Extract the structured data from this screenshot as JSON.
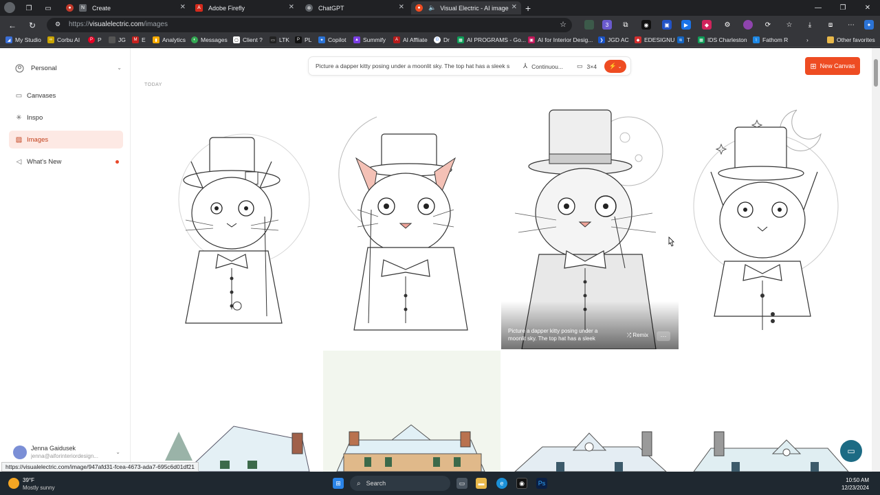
{
  "tabs": [
    {
      "label": "Create",
      "active": false
    },
    {
      "label": "Adobe Firefly",
      "active": false
    },
    {
      "label": "ChatGPT",
      "active": false
    },
    {
      "label": "Visual Electric - AI image ge",
      "active": true
    }
  ],
  "address_bar": {
    "scheme": "https://",
    "host": "visualelectric.com",
    "path": "/images"
  },
  "bookmarks": [
    "My Studio",
    "Corbu AI",
    "P",
    "JG",
    "E",
    "Analytics",
    "Messages",
    "Client ?",
    "LTK",
    "PL",
    "Copilot",
    "Summify",
    "AI Affliate",
    "Dr",
    "AI PROGRAMS - Go...",
    "AI for Interior Desig...",
    "JGD AC",
    "EDESIGNU",
    "T",
    "IDS Charleston",
    "Fathom R",
    "Other favorites"
  ],
  "sidebar": {
    "workspace": "Personal",
    "items": [
      {
        "label": "Canvases",
        "icon": "canvas-icon"
      },
      {
        "label": "Inspo",
        "icon": "sparkle-icon"
      },
      {
        "label": "Images",
        "icon": "image-icon",
        "active": true
      },
      {
        "label": "What's New",
        "icon": "megaphone-icon",
        "badge": true
      }
    ],
    "user": {
      "name": "Jenna Gaidusek",
      "email": "jenna@aiforinteriordesign..."
    }
  },
  "prompt_bar": {
    "text": "Picture a dapper kitty posing under a moonlit sky. The top hat has a sleek s",
    "style": "Continuou...",
    "ratio": "3×4"
  },
  "new_canvas_label": "New Canvas",
  "section_label": "TODAY",
  "hover_overlay": {
    "text": "Picture a dapper kitty posing under a moonlit sky. The top hat has a sleek",
    "remix_label": "Remix",
    "more_label": "···"
  },
  "status_url": "https://visualelectric.com/image/947afd31-fcea-4673-ada7-695c6d01df21",
  "taskbar": {
    "weather_temp": "39°F",
    "weather_desc": "Mostly sunny",
    "search_label": "Search",
    "time": "10:50 AM",
    "date": "12/23/2024"
  },
  "colors": {
    "accent": "#ee4c22",
    "active_nav_bg": "#fde9e4"
  }
}
